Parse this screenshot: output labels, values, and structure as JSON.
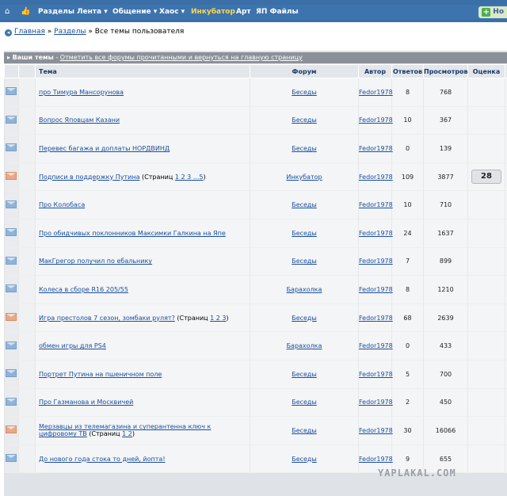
{
  "topbar": {
    "items": [
      {
        "label": "Разделы",
        "dropdown": false
      },
      {
        "label": "Лента",
        "dropdown": true
      },
      {
        "label": "Общение",
        "dropdown": true
      },
      {
        "label": "Хаос",
        "dropdown": true
      },
      {
        "label": "Инкубатор",
        "dropdown": false,
        "color": "#ffd84a"
      },
      {
        "label": "Арт",
        "dropdown": false
      },
      {
        "label": "ЯП Файлы",
        "dropdown": false
      }
    ],
    "new_label": "Но",
    "colors": {
      "bar": "#3d74ae",
      "highlight": "#ffd84a"
    }
  },
  "breadcrumb": {
    "home": "Главная",
    "sep1": "»",
    "sections": "Разделы",
    "sep2": "»",
    "current": "Все темы пользователя"
  },
  "panel": {
    "title_bold": "Ваши темы",
    "title_sep": " - ",
    "title_link": "Отметить все форумы прочитанными и вернуться на главную страницу"
  },
  "columns": {
    "topic": "Тема",
    "forum": "Форум",
    "author": "Автор",
    "replies": "Ответов",
    "views": "Просмотров",
    "rating": "Оценка"
  },
  "topics": [
    {
      "title": "про Тимура Мансорунова",
      "pages_prefix": "",
      "pages": "",
      "pages_suffix": "",
      "forum": "Беседы",
      "author": "Fedor1978",
      "replies": "8",
      "views": "768",
      "rating": "",
      "hot": false
    },
    {
      "title": "Вопрос Яповцам Казани",
      "pages_prefix": "",
      "pages": "",
      "pages_suffix": "",
      "forum": "Беседы",
      "author": "Fedor1978",
      "replies": "10",
      "views": "367",
      "rating": "",
      "hot": false
    },
    {
      "title": "Перевес багажа и доплаты НОРДВИНД",
      "pages_prefix": "",
      "pages": "",
      "pages_suffix": "",
      "forum": "Беседы",
      "author": "Fedor1978",
      "replies": "0",
      "views": "139",
      "rating": "",
      "hot": false
    },
    {
      "title": "Подписи в поддержку Путина",
      "pages_prefix": " (Страниц ",
      "pages": "1 2 3 ...5",
      "pages_suffix": ")",
      "forum": "Инкубатор",
      "author": "Fedor1978",
      "replies": "109",
      "views": "3877",
      "rating": "28",
      "hot": true
    },
    {
      "title": "Про Колобаса",
      "pages_prefix": "",
      "pages": "",
      "pages_suffix": "",
      "forum": "Беседы",
      "author": "Fedor1978",
      "replies": "10",
      "views": "710",
      "rating": "",
      "hot": false
    },
    {
      "title": "Про обидчивых поклонников Максимки Галкина на Япе",
      "pages_prefix": "",
      "pages": "",
      "pages_suffix": "",
      "forum": "Беседы",
      "author": "Fedor1978",
      "replies": "24",
      "views": "1637",
      "rating": "",
      "hot": false
    },
    {
      "title": "МакГрегор получил по ебальнику",
      "pages_prefix": "",
      "pages": "",
      "pages_suffix": "",
      "forum": "Беседы",
      "author": "Fedor1978",
      "replies": "7",
      "views": "899",
      "rating": "",
      "hot": false
    },
    {
      "title": "Колеса в сборе R16 205/55",
      "pages_prefix": "",
      "pages": "",
      "pages_suffix": "",
      "forum": "Барахолка",
      "author": "Fedor1978",
      "replies": "8",
      "views": "1210",
      "rating": "",
      "hot": false
    },
    {
      "title": "Игра престолов 7 сезон, зомбаки рулят?",
      "pages_prefix": " (Страниц ",
      "pages": "1 2 3",
      "pages_suffix": ")",
      "forum": "Беседы",
      "author": "Fedor1978",
      "replies": "68",
      "views": "2639",
      "rating": "",
      "hot": true
    },
    {
      "title": "обмен игры для PS4",
      "pages_prefix": "",
      "pages": "",
      "pages_suffix": "",
      "forum": "Барахолка",
      "author": "Fedor1978",
      "replies": "0",
      "views": "433",
      "rating": "",
      "hot": false
    },
    {
      "title": "Портрет Путина на пшеничном поле",
      "pages_prefix": "",
      "pages": "",
      "pages_suffix": "",
      "forum": "Беседы",
      "author": "Fedor1978",
      "replies": "5",
      "views": "700",
      "rating": "",
      "hot": false
    },
    {
      "title": "Про Газманова и Москвичей",
      "pages_prefix": "",
      "pages": "",
      "pages_suffix": "",
      "forum": "Беседы",
      "author": "Fedor1978",
      "replies": "2",
      "views": "450",
      "rating": "",
      "hot": false
    },
    {
      "title": "Мерзавцы из телемагазина и суперантенна ключ к цифровому ТВ",
      "pages_prefix": " (Страниц ",
      "pages": "1 2",
      "pages_suffix": ")",
      "forum": "Беседы",
      "author": "Fedor1978",
      "replies": "30",
      "views": "16066",
      "rating": "",
      "hot": true
    },
    {
      "title": "До нового года стока то дней, йопта!",
      "pages_prefix": "",
      "pages": "",
      "pages_suffix": "",
      "forum": "Беседы",
      "author": "Fedor1978",
      "replies": "9",
      "views": "655",
      "rating": "",
      "hot": false
    }
  ],
  "watermark": "YAPLAKAL.COM"
}
